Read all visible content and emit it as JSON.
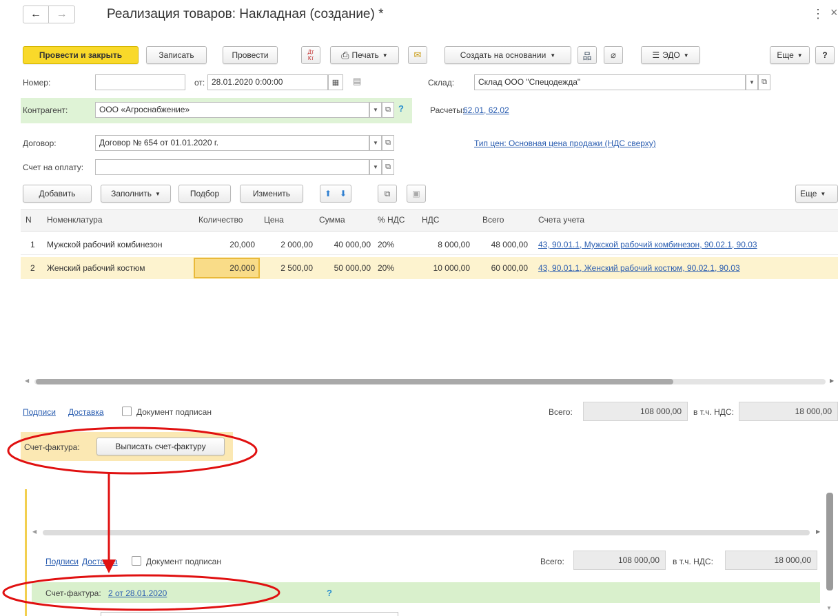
{
  "window": {
    "title": "Реализация товаров: Накладная (создание) *",
    "menu_glyph": "⋮",
    "close_glyph": "×"
  },
  "toolbar": {
    "post_close": "Провести и закрыть",
    "save": "Записать",
    "post": "Провести",
    "dtkt_top": "Дт",
    "dtkt_bottom": "Кт",
    "print": "Печать",
    "create_based": "Создать на основании",
    "edo": "ЭДО",
    "more": "Еще",
    "help": "?"
  },
  "form": {
    "number_label": "Номер:",
    "number_value": "",
    "date_label": "от:",
    "date_value": "28.01.2020  0:00:00",
    "warehouse_label": "Склад:",
    "warehouse_value": "Склад ООО \"Спецодежда\"",
    "counterparty_label": "Контрагент:",
    "counterparty_value": "ООО «Агроснабжение»",
    "counterparty_help": "?",
    "settlements_label": "Расчеты:",
    "settlements_link": "62.01, 62.02",
    "contract_label": "Договор:",
    "contract_value": "Договор № 654 от 01.01.2020 г.",
    "price_type_link": "Тип цен: Основная цена продажи (НДС сверху)",
    "invoice_label": "Счет на оплату:",
    "invoice_value": ""
  },
  "table_toolbar": {
    "add": "Добавить",
    "fill": "Заполнить",
    "pick": "Подбор",
    "change": "Изменить",
    "more": "Еще"
  },
  "table": {
    "headers": [
      "N",
      "Номенклатура",
      "Количество",
      "Цена",
      "Сумма",
      "% НДС",
      "НДС",
      "Всего",
      "Счета учета"
    ],
    "rows": [
      {
        "n": "1",
        "name": "Мужской рабочий комбинезон",
        "qty": "20,000",
        "price": "2 000,00",
        "sum": "40 000,00",
        "vat_rate": "20%",
        "vat": "8 000,00",
        "total": "48 000,00",
        "accounts": "43, 90.01.1, Мужской рабочий комбинезон, 90.02.1, 90.03"
      },
      {
        "n": "2",
        "name": "Женский рабочий костюм",
        "qty": "20,000",
        "price": "2 500,00",
        "sum": "50 000,00",
        "vat_rate": "20%",
        "vat": "10 000,00",
        "total": "60 000,00",
        "accounts": "43, 90.01.1, Женский рабочий костюм, 90.02.1, 90.03"
      }
    ]
  },
  "footer_top": {
    "signatures": "Подписи",
    "delivery": "Доставка",
    "signed": "Документ подписан",
    "total_label": "Всего:",
    "total_value": "108 000,00",
    "vat_label": "в т.ч. НДС:",
    "vat_value": "18 000,00",
    "invoice_label": "Счет-фактура:",
    "invoice_button": "Выписать счет-фактуру"
  },
  "footer_bottom": {
    "signatures": "Подписи",
    "delivery": "Доставка",
    "signed": "Документ подписан",
    "total_label": "Всего:",
    "total_value": "108 000,00",
    "vat_label": "в т.ч. НДС:",
    "vat_value": "18 000,00",
    "invoice_label": "Счет-фактура:",
    "invoice_link": "2 от 28.01.2020",
    "help": "?"
  },
  "colors": {
    "primary_button": "#f9d92a",
    "link": "#2a5db0",
    "highlight_row": "#fdf3cf",
    "counterparty_bg": "#dff3d6",
    "invoice_bg_top": "#fbe8b3",
    "invoice_bg_bottom": "#d9f0cc",
    "annotation": "#e01010"
  }
}
